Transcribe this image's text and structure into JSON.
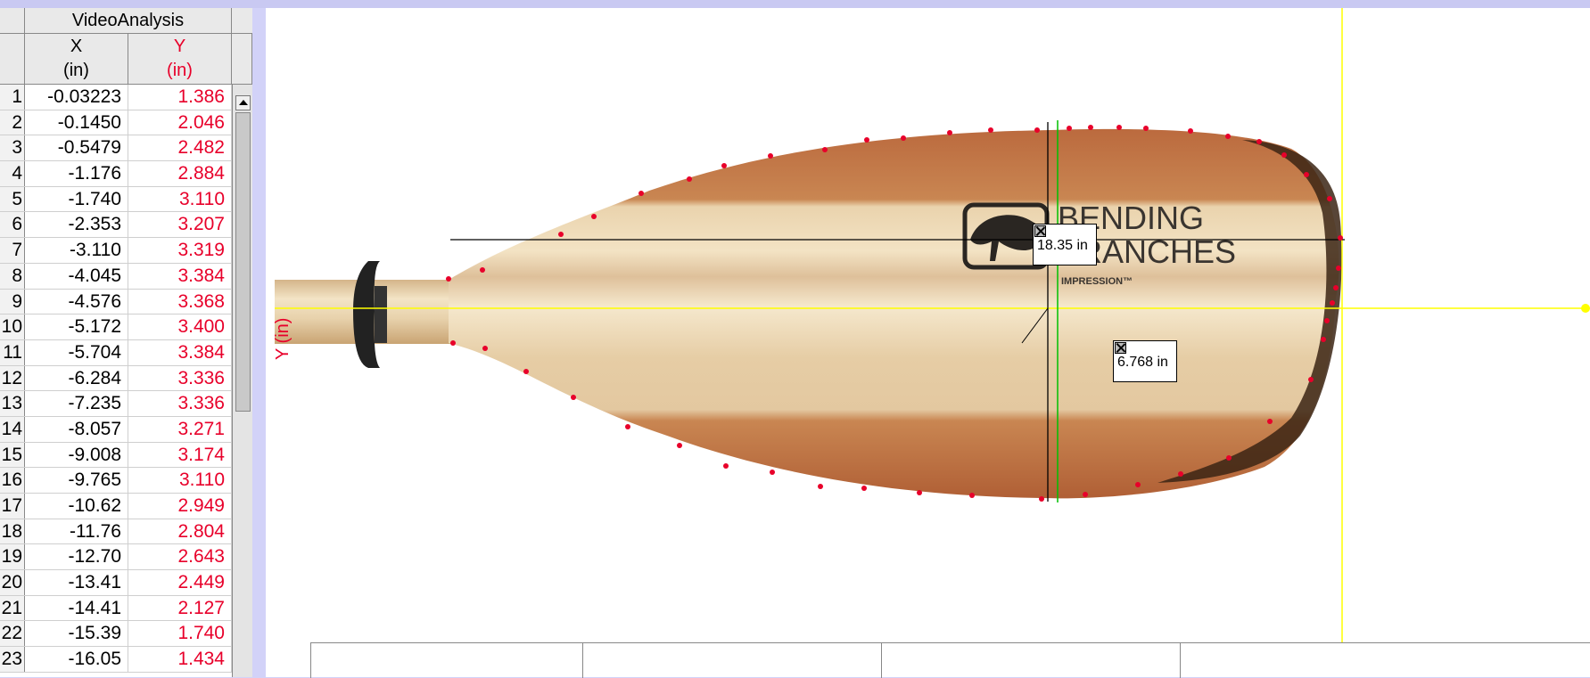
{
  "table": {
    "title": "VideoAnalysis",
    "x_header": "X",
    "x_unit": "(in)",
    "y_header": "Y",
    "y_unit": "(in)",
    "rows": [
      {
        "i": "1",
        "x": "-0.03223",
        "y": "1.386"
      },
      {
        "i": "2",
        "x": "-0.1450",
        "y": "2.046"
      },
      {
        "i": "3",
        "x": "-0.5479",
        "y": "2.482"
      },
      {
        "i": "4",
        "x": "-1.176",
        "y": "2.884"
      },
      {
        "i": "5",
        "x": "-1.740",
        "y": "3.110"
      },
      {
        "i": "6",
        "x": "-2.353",
        "y": "3.207"
      },
      {
        "i": "7",
        "x": "-3.110",
        "y": "3.319"
      },
      {
        "i": "8",
        "x": "-4.045",
        "y": "3.384"
      },
      {
        "i": "9",
        "x": "-4.576",
        "y": "3.368"
      },
      {
        "i": "10",
        "x": "-5.172",
        "y": "3.400"
      },
      {
        "i": "11",
        "x": "-5.704",
        "y": "3.384"
      },
      {
        "i": "12",
        "x": "-6.284",
        "y": "3.336"
      },
      {
        "i": "13",
        "x": "-7.235",
        "y": "3.336"
      },
      {
        "i": "14",
        "x": "-8.057",
        "y": "3.271"
      },
      {
        "i": "15",
        "x": "-9.008",
        "y": "3.174"
      },
      {
        "i": "16",
        "x": "-9.765",
        "y": "3.110"
      },
      {
        "i": "17",
        "x": "-10.62",
        "y": "2.949"
      },
      {
        "i": "18",
        "x": "-11.76",
        "y": "2.804"
      },
      {
        "i": "19",
        "x": "-12.70",
        "y": "2.643"
      },
      {
        "i": "20",
        "x": "-13.41",
        "y": "2.449"
      },
      {
        "i": "21",
        "x": "-14.41",
        "y": "2.127"
      },
      {
        "i": "22",
        "x": "-15.39",
        "y": "1.740"
      },
      {
        "i": "23",
        "x": "-16.05",
        "y": "1.434"
      }
    ]
  },
  "graph": {
    "y_axis_label": "Y (in)",
    "length_measure": "18.35 in",
    "width_measure": "6.768 in",
    "logo": {
      "line1": "BENDING",
      "line2": "BRANCHES",
      "line3": "IMPRESSION™"
    }
  },
  "colors": {
    "point_marker": "#e8002a",
    "origin_axis": "#ffff00",
    "measure_line": "#000000",
    "calibration_line": "#00c000"
  }
}
